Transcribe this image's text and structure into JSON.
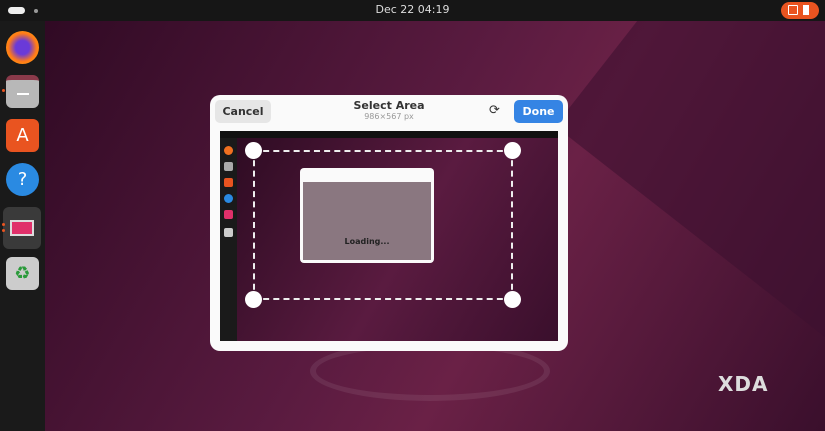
{
  "topbar": {
    "clock": "Dec 22  04:19"
  },
  "dock": {
    "items": [
      {
        "name": "firefox",
        "icon": "firefox-icon"
      },
      {
        "name": "files",
        "icon": "folder-icon",
        "running": true
      },
      {
        "name": "app-center",
        "icon": "store-icon",
        "glyph": "A"
      },
      {
        "name": "help",
        "icon": "help-icon",
        "glyph": "?"
      },
      {
        "name": "screenshot",
        "icon": "screenshot-icon",
        "running": true
      },
      {
        "name": "trash",
        "icon": "trash-icon",
        "glyph": "♻"
      }
    ]
  },
  "dialog": {
    "cancel": "Cancel",
    "title": "Select Area",
    "subtitle": "986×567 px",
    "done": "Done",
    "reset_glyph": "⟳"
  },
  "preview": {
    "loading": "Loading..."
  },
  "watermark": "XDA",
  "colors": {
    "accent": "#3584e4",
    "ubuntu_orange": "#e95420"
  }
}
